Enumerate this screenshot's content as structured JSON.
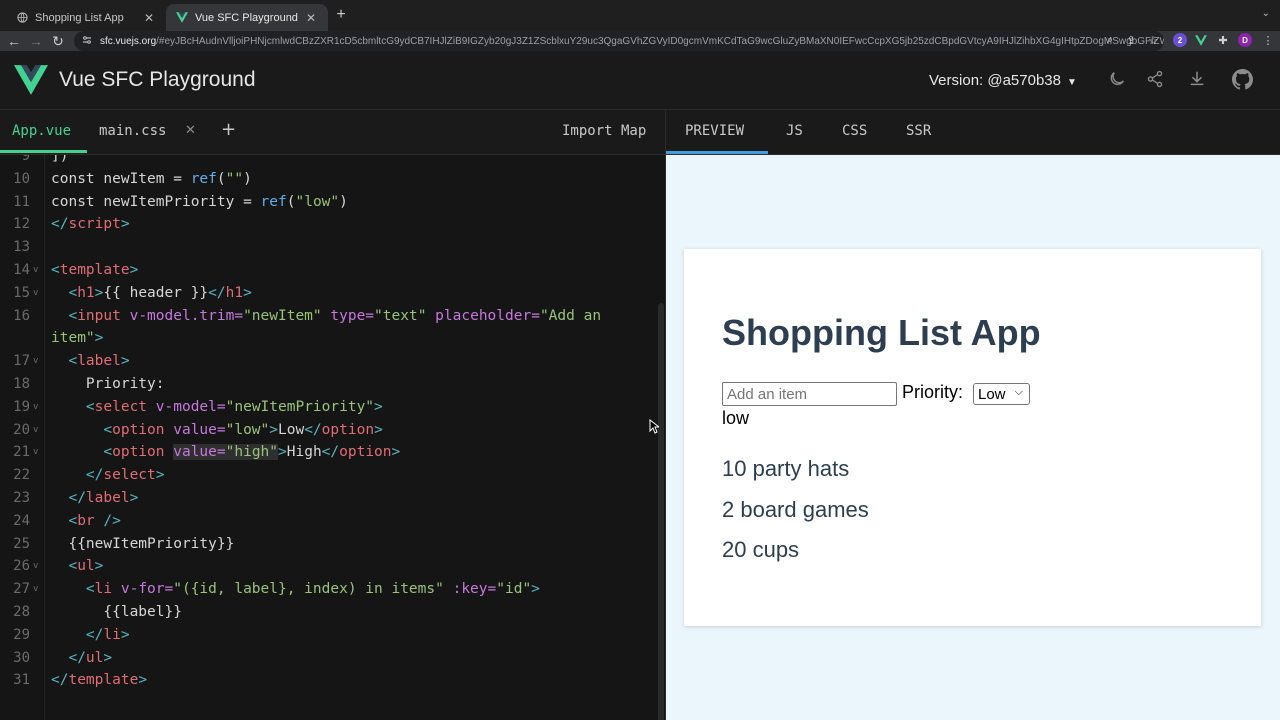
{
  "browser": {
    "tabs": [
      {
        "title": "Shopping List App",
        "active": false
      },
      {
        "title": "Vue SFC Playground",
        "active": true
      }
    ],
    "url_host": "sfc.vuejs.org",
    "url_rest": "/#eyJBcHAudnVlljoiPHNjcmlwdCBzZXR1cD5cbmltcG9ydCB7IHJlZiB9IGZyb20gJ3Z1ZScblxuY29uc3QgaGVhZGVyID0gcmVmKCdTaG9wcGluZyBMaXN0IEFwcCcpXG5jb25zdCBpdGVtcyA9IHJlZihbXG4gIHtpZDogMSwgbGFiZWw6ICcxMCBwYXJ0eSBoYXRzJ30sXG4gIHtpZDogMiwgbGFiZWw6ICcyIGJvYXJkIGdhbWVzJ30sXG4gIHtpZDogMywgbGFiZWw6ICcyMCBjdXBzJ30sXG5dKVxuY29uc3QgbmV3SXRlbSA9IHJlZignJyl...",
    "profile_initial": "D"
  },
  "header": {
    "title": "Vue SFC Playground",
    "version": "Version: @a570b38"
  },
  "file_tabs": [
    {
      "label": "App.vue",
      "active": true
    },
    {
      "label": "main.css",
      "active": false
    }
  ],
  "import_map_label": "Import Map",
  "output_tabs": [
    {
      "label": "PREVIEW",
      "active": true
    },
    {
      "label": "JS",
      "active": false
    },
    {
      "label": "CSS",
      "active": false
    },
    {
      "label": "SSR",
      "active": false
    }
  ],
  "editor": {
    "lines": [
      {
        "n": "9",
        "fold": false,
        "tokens": [
          {
            "t": "])",
            "c": "txt"
          }
        ]
      },
      {
        "n": "10",
        "fold": false,
        "tokens": [
          {
            "t": "const ",
            "c": "txt"
          },
          {
            "t": "newItem",
            "c": "txt"
          },
          {
            "t": " = ",
            "c": "txt"
          },
          {
            "t": "ref",
            "c": "fn"
          },
          {
            "t": "(",
            "c": "txt"
          },
          {
            "t": "\"\"",
            "c": "str"
          },
          {
            "t": ")",
            "c": "txt"
          }
        ]
      },
      {
        "n": "11",
        "fold": false,
        "tokens": [
          {
            "t": "const ",
            "c": "txt"
          },
          {
            "t": "newItemPriority",
            "c": "txt"
          },
          {
            "t": " = ",
            "c": "txt"
          },
          {
            "t": "ref",
            "c": "fn"
          },
          {
            "t": "(",
            "c": "txt"
          },
          {
            "t": "\"low\"",
            "c": "str"
          },
          {
            "t": ")",
            "c": "txt"
          }
        ]
      },
      {
        "n": "12",
        "fold": false,
        "tokens": [
          {
            "t": "</",
            "c": "ang"
          },
          {
            "t": "script",
            "c": "tag"
          },
          {
            "t": ">",
            "c": "ang"
          }
        ]
      },
      {
        "n": "13",
        "fold": false,
        "tokens": []
      },
      {
        "n": "14",
        "fold": true,
        "tokens": [
          {
            "t": "<",
            "c": "ang"
          },
          {
            "t": "template",
            "c": "tag"
          },
          {
            "t": ">",
            "c": "ang"
          }
        ]
      },
      {
        "n": "15",
        "fold": true,
        "tokens": [
          {
            "t": "  <",
            "c": "ang"
          },
          {
            "t": "h1",
            "c": "tag"
          },
          {
            "t": ">",
            "c": "ang"
          },
          {
            "t": "{{ header }}",
            "c": "mus"
          },
          {
            "t": "</",
            "c": "ang"
          },
          {
            "t": "h1",
            "c": "tag"
          },
          {
            "t": ">",
            "c": "ang"
          }
        ]
      },
      {
        "n": "16",
        "fold": false,
        "tokens": [
          {
            "t": "  <",
            "c": "ang"
          },
          {
            "t": "input",
            "c": "tag"
          },
          {
            "t": " v-model.trim=",
            "c": "attr"
          },
          {
            "t": "\"newItem\"",
            "c": "str"
          },
          {
            "t": " type=",
            "c": "attr"
          },
          {
            "t": "\"text\"",
            "c": "str"
          },
          {
            "t": " placeholder=",
            "c": "attr"
          },
          {
            "t": "\"Add an",
            "c": "str"
          }
        ]
      },
      {
        "n": "",
        "fold": false,
        "tokens": [
          {
            "t": "item\"",
            "c": "str"
          },
          {
            "t": ">",
            "c": "ang"
          }
        ]
      },
      {
        "n": "17",
        "fold": true,
        "tokens": [
          {
            "t": "  <",
            "c": "ang"
          },
          {
            "t": "label",
            "c": "tag"
          },
          {
            "t": ">",
            "c": "ang"
          }
        ]
      },
      {
        "n": "18",
        "fold": false,
        "tokens": [
          {
            "t": "    Priority:",
            "c": "txt"
          }
        ]
      },
      {
        "n": "19",
        "fold": true,
        "tokens": [
          {
            "t": "    <",
            "c": "ang"
          },
          {
            "t": "select",
            "c": "tag"
          },
          {
            "t": " v-model=",
            "c": "attr"
          },
          {
            "t": "\"newItemPriority\"",
            "c": "str"
          },
          {
            "t": ">",
            "c": "ang"
          }
        ]
      },
      {
        "n": "20",
        "fold": true,
        "tokens": [
          {
            "t": "      <",
            "c": "ang"
          },
          {
            "t": "option",
            "c": "tag"
          },
          {
            "t": " value=",
            "c": "attr"
          },
          {
            "t": "\"low\"",
            "c": "str"
          },
          {
            "t": ">",
            "c": "ang"
          },
          {
            "t": "Low",
            "c": "txt"
          },
          {
            "t": "</",
            "c": "ang"
          },
          {
            "t": "option",
            "c": "tag"
          },
          {
            "t": ">",
            "c": "ang"
          }
        ]
      },
      {
        "n": "21",
        "fold": true,
        "tokens": [
          {
            "t": "      <",
            "c": "ang"
          },
          {
            "t": "option",
            "c": "tag"
          },
          {
            "t": " ",
            "c": "txt"
          },
          {
            "t": "value=",
            "c": "attr hl"
          },
          {
            "t": "\"high\"",
            "c": "str hl"
          },
          {
            "t": ">",
            "c": "ang"
          },
          {
            "t": "High",
            "c": "txt"
          },
          {
            "t": "</",
            "c": "ang"
          },
          {
            "t": "option",
            "c": "tag"
          },
          {
            "t": ">",
            "c": "ang"
          }
        ]
      },
      {
        "n": "22",
        "fold": false,
        "tokens": [
          {
            "t": "    </",
            "c": "ang"
          },
          {
            "t": "select",
            "c": "tag"
          },
          {
            "t": ">",
            "c": "ang"
          }
        ]
      },
      {
        "n": "23",
        "fold": false,
        "tokens": [
          {
            "t": "  </",
            "c": "ang"
          },
          {
            "t": "label",
            "c": "tag"
          },
          {
            "t": ">",
            "c": "ang"
          }
        ]
      },
      {
        "n": "24",
        "fold": false,
        "tokens": [
          {
            "t": "  <",
            "c": "ang"
          },
          {
            "t": "br",
            "c": "tag"
          },
          {
            "t": " />",
            "c": "ang"
          }
        ]
      },
      {
        "n": "25",
        "fold": false,
        "tokens": [
          {
            "t": "  {{newItemPriority}}",
            "c": "mus"
          }
        ]
      },
      {
        "n": "26",
        "fold": true,
        "tokens": [
          {
            "t": "  <",
            "c": "ang"
          },
          {
            "t": "ul",
            "c": "tag"
          },
          {
            "t": ">",
            "c": "ang"
          }
        ]
      },
      {
        "n": "27",
        "fold": true,
        "tokens": [
          {
            "t": "    <",
            "c": "ang"
          },
          {
            "t": "li",
            "c": "tag"
          },
          {
            "t": " v-for=",
            "c": "attr"
          },
          {
            "t": "\"({id, label}, index) in items\"",
            "c": "str"
          },
          {
            "t": " :key=",
            "c": "attr"
          },
          {
            "t": "\"id\"",
            "c": "str"
          },
          {
            "t": ">",
            "c": "ang"
          }
        ]
      },
      {
        "n": "28",
        "fold": false,
        "tokens": [
          {
            "t": "      {{label}}",
            "c": "mus"
          }
        ]
      },
      {
        "n": "29",
        "fold": false,
        "tokens": [
          {
            "t": "    </",
            "c": "ang"
          },
          {
            "t": "li",
            "c": "tag"
          },
          {
            "t": ">",
            "c": "ang"
          }
        ]
      },
      {
        "n": "30",
        "fold": false,
        "tokens": [
          {
            "t": "  </",
            "c": "ang"
          },
          {
            "t": "ul",
            "c": "tag"
          },
          {
            "t": ">",
            "c": "ang"
          }
        ]
      },
      {
        "n": "31",
        "fold": false,
        "tokens": [
          {
            "t": "</",
            "c": "ang"
          },
          {
            "t": "template",
            "c": "tag"
          },
          {
            "t": ">",
            "c": "ang"
          }
        ]
      }
    ]
  },
  "preview": {
    "heading": "Shopping List App",
    "input_placeholder": "Add an item",
    "priority_label": "Priority:",
    "select_value": "Low",
    "priority_value": "low",
    "items": [
      "10 party hats",
      "2 board games",
      "20 cups"
    ]
  },
  "colors": {
    "vue_green": "#42d392",
    "preview_bg": "#eaf5fc",
    "preview_tab_underline": "#3f9ee0"
  }
}
